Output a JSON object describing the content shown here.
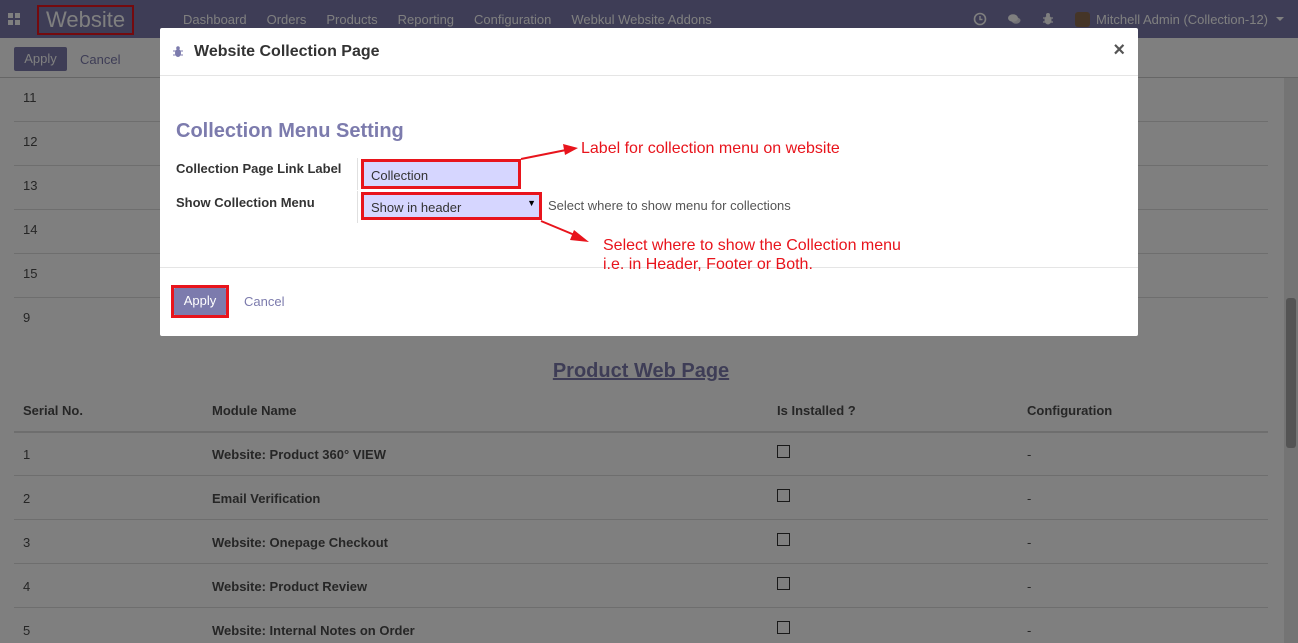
{
  "navbar": {
    "brand": "Website",
    "menu": [
      "Dashboard",
      "Orders",
      "Products",
      "Reporting",
      "Configuration",
      "Webkul Website Addons"
    ],
    "user": "Mitchell Admin (Collection-12)"
  },
  "control_panel": {
    "apply_label": "Apply",
    "cancel_label": "Cancel"
  },
  "background_table": {
    "top_rows": [
      "11",
      "12",
      "13",
      "14",
      "15",
      "9"
    ],
    "section_title": "Product Web Page",
    "headers": [
      "Serial No.",
      "Module Name",
      "Is Installed ?",
      "Configuration"
    ],
    "rows": [
      {
        "serial": "1",
        "module": "Website: Product 360° VIEW",
        "config": "-"
      },
      {
        "serial": "2",
        "module": "Email Verification",
        "config": "-"
      },
      {
        "serial": "3",
        "module": "Website: Onepage Checkout",
        "config": "-"
      },
      {
        "serial": "4",
        "module": "Website: Product Review",
        "config": "-"
      },
      {
        "serial": "5",
        "module": "Website: Internal Notes on Order",
        "config": "-"
      }
    ]
  },
  "modal": {
    "title": "Website Collection Page",
    "close_glyph": "×",
    "section_title": "Collection Menu Setting",
    "link_label_field": "Collection Page Link Label",
    "link_label_value": "Collection",
    "show_menu_field": "Show Collection Menu",
    "show_menu_value": "Show in header",
    "show_menu_help": "Select where to show menu for collections",
    "apply_label": "Apply",
    "cancel_label": "Cancel"
  },
  "annotations": {
    "label_note": "Label for collection menu on website",
    "menu_note_line1": "Select where to show the Collection menu",
    "menu_note_line2": "i.e. in Header, Footer or Both."
  },
  "colors": {
    "brand": "#7c7bad",
    "highlight": "#e8141c",
    "input_bg": "#d6d6ff"
  }
}
